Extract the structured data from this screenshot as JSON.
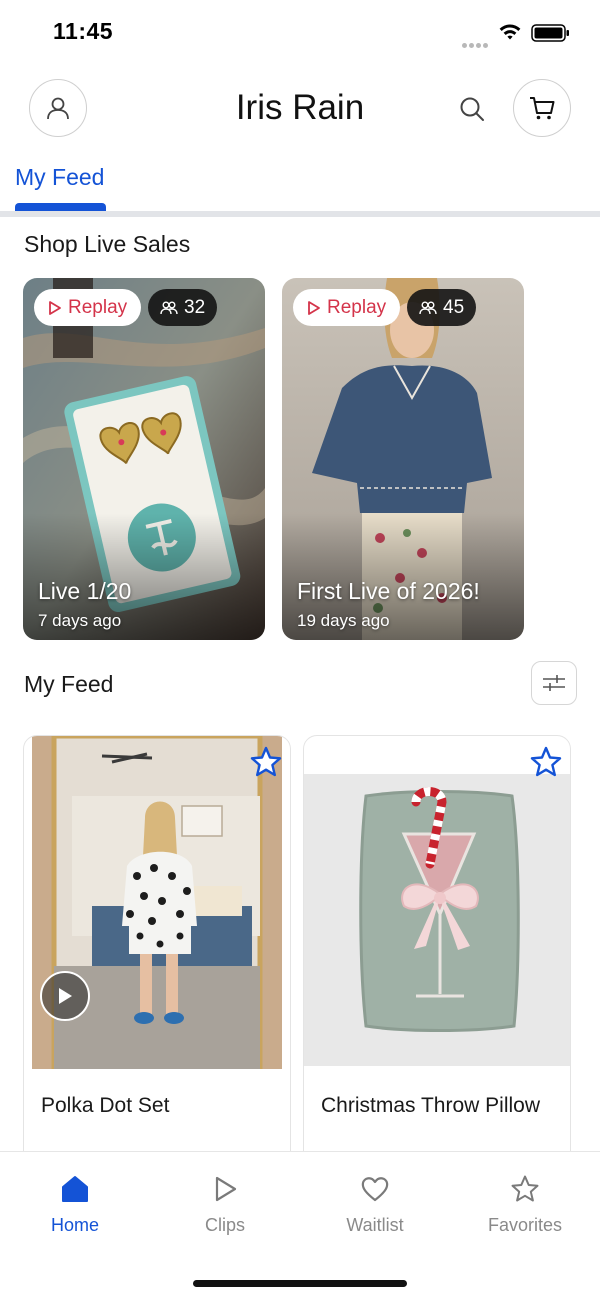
{
  "status_bar": {
    "time": "11:45"
  },
  "header": {
    "title": "Iris Rain"
  },
  "tabs": {
    "active_label": "My Feed"
  },
  "live_section": {
    "title": "Shop Live Sales",
    "cards": [
      {
        "badge": "Replay",
        "viewers": "32",
        "name": "Live 1/20",
        "ago": "7 days ago"
      },
      {
        "badge": "Replay",
        "viewers": "45",
        "name": "First Live of 2026!",
        "ago": "19 days ago"
      }
    ]
  },
  "feed_section": {
    "title": "My Feed",
    "items": [
      {
        "name": "Polka Dot Set",
        "has_video": true
      },
      {
        "name": "Christmas Throw Pillow",
        "has_video": false
      }
    ]
  },
  "bottom_nav": {
    "items": [
      {
        "label": "Home",
        "icon": "home-icon",
        "active": true
      },
      {
        "label": "Clips",
        "icon": "play-icon",
        "active": false
      },
      {
        "label": "Waitlist",
        "icon": "heart-icon",
        "active": false
      },
      {
        "label": "Favorites",
        "icon": "star-icon",
        "active": false
      }
    ]
  },
  "colors": {
    "accent": "#1453d6",
    "replay": "#d4344a",
    "tab_divider": "#e2e4e8"
  }
}
